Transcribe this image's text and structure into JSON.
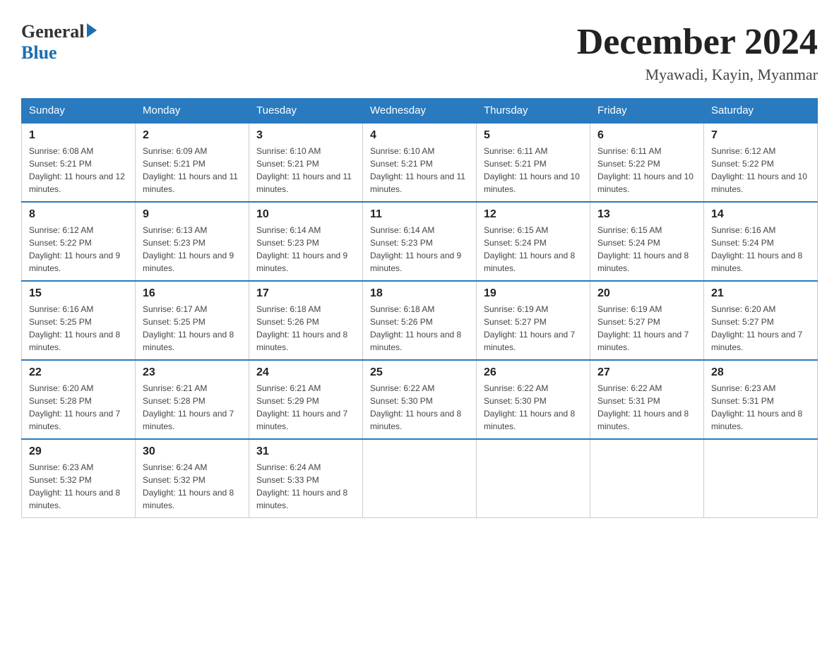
{
  "header": {
    "logo_general": "General",
    "logo_blue": "Blue",
    "title": "December 2024",
    "subtitle": "Myawadi, Kayin, Myanmar"
  },
  "calendar": {
    "days_of_week": [
      "Sunday",
      "Monday",
      "Tuesday",
      "Wednesday",
      "Thursday",
      "Friday",
      "Saturday"
    ],
    "weeks": [
      [
        {
          "day": "1",
          "sunrise": "6:08 AM",
          "sunset": "5:21 PM",
          "daylight": "11 hours and 12 minutes."
        },
        {
          "day": "2",
          "sunrise": "6:09 AM",
          "sunset": "5:21 PM",
          "daylight": "11 hours and 11 minutes."
        },
        {
          "day": "3",
          "sunrise": "6:10 AM",
          "sunset": "5:21 PM",
          "daylight": "11 hours and 11 minutes."
        },
        {
          "day": "4",
          "sunrise": "6:10 AM",
          "sunset": "5:21 PM",
          "daylight": "11 hours and 11 minutes."
        },
        {
          "day": "5",
          "sunrise": "6:11 AM",
          "sunset": "5:21 PM",
          "daylight": "11 hours and 10 minutes."
        },
        {
          "day": "6",
          "sunrise": "6:11 AM",
          "sunset": "5:22 PM",
          "daylight": "11 hours and 10 minutes."
        },
        {
          "day": "7",
          "sunrise": "6:12 AM",
          "sunset": "5:22 PM",
          "daylight": "11 hours and 10 minutes."
        }
      ],
      [
        {
          "day": "8",
          "sunrise": "6:12 AM",
          "sunset": "5:22 PM",
          "daylight": "11 hours and 9 minutes."
        },
        {
          "day": "9",
          "sunrise": "6:13 AM",
          "sunset": "5:23 PM",
          "daylight": "11 hours and 9 minutes."
        },
        {
          "day": "10",
          "sunrise": "6:14 AM",
          "sunset": "5:23 PM",
          "daylight": "11 hours and 9 minutes."
        },
        {
          "day": "11",
          "sunrise": "6:14 AM",
          "sunset": "5:23 PM",
          "daylight": "11 hours and 9 minutes."
        },
        {
          "day": "12",
          "sunrise": "6:15 AM",
          "sunset": "5:24 PM",
          "daylight": "11 hours and 8 minutes."
        },
        {
          "day": "13",
          "sunrise": "6:15 AM",
          "sunset": "5:24 PM",
          "daylight": "11 hours and 8 minutes."
        },
        {
          "day": "14",
          "sunrise": "6:16 AM",
          "sunset": "5:24 PM",
          "daylight": "11 hours and 8 minutes."
        }
      ],
      [
        {
          "day": "15",
          "sunrise": "6:16 AM",
          "sunset": "5:25 PM",
          "daylight": "11 hours and 8 minutes."
        },
        {
          "day": "16",
          "sunrise": "6:17 AM",
          "sunset": "5:25 PM",
          "daylight": "11 hours and 8 minutes."
        },
        {
          "day": "17",
          "sunrise": "6:18 AM",
          "sunset": "5:26 PM",
          "daylight": "11 hours and 8 minutes."
        },
        {
          "day": "18",
          "sunrise": "6:18 AM",
          "sunset": "5:26 PM",
          "daylight": "11 hours and 8 minutes."
        },
        {
          "day": "19",
          "sunrise": "6:19 AM",
          "sunset": "5:27 PM",
          "daylight": "11 hours and 7 minutes."
        },
        {
          "day": "20",
          "sunrise": "6:19 AM",
          "sunset": "5:27 PM",
          "daylight": "11 hours and 7 minutes."
        },
        {
          "day": "21",
          "sunrise": "6:20 AM",
          "sunset": "5:27 PM",
          "daylight": "11 hours and 7 minutes."
        }
      ],
      [
        {
          "day": "22",
          "sunrise": "6:20 AM",
          "sunset": "5:28 PM",
          "daylight": "11 hours and 7 minutes."
        },
        {
          "day": "23",
          "sunrise": "6:21 AM",
          "sunset": "5:28 PM",
          "daylight": "11 hours and 7 minutes."
        },
        {
          "day": "24",
          "sunrise": "6:21 AM",
          "sunset": "5:29 PM",
          "daylight": "11 hours and 7 minutes."
        },
        {
          "day": "25",
          "sunrise": "6:22 AM",
          "sunset": "5:30 PM",
          "daylight": "11 hours and 8 minutes."
        },
        {
          "day": "26",
          "sunrise": "6:22 AM",
          "sunset": "5:30 PM",
          "daylight": "11 hours and 8 minutes."
        },
        {
          "day": "27",
          "sunrise": "6:22 AM",
          "sunset": "5:31 PM",
          "daylight": "11 hours and 8 minutes."
        },
        {
          "day": "28",
          "sunrise": "6:23 AM",
          "sunset": "5:31 PM",
          "daylight": "11 hours and 8 minutes."
        }
      ],
      [
        {
          "day": "29",
          "sunrise": "6:23 AM",
          "sunset": "5:32 PM",
          "daylight": "11 hours and 8 minutes."
        },
        {
          "day": "30",
          "sunrise": "6:24 AM",
          "sunset": "5:32 PM",
          "daylight": "11 hours and 8 minutes."
        },
        {
          "day": "31",
          "sunrise": "6:24 AM",
          "sunset": "5:33 PM",
          "daylight": "11 hours and 8 minutes."
        },
        null,
        null,
        null,
        null
      ]
    ]
  }
}
